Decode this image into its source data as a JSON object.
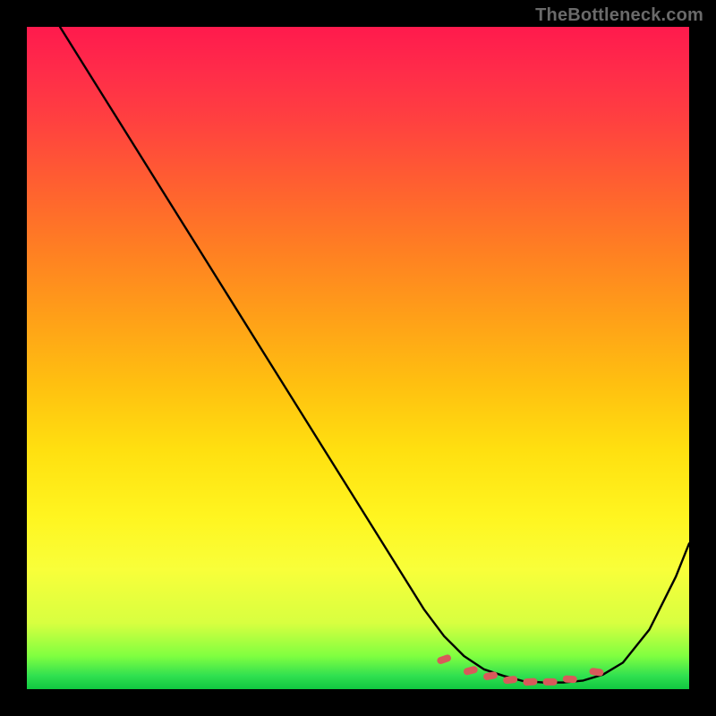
{
  "watermark": "TheBottleneck.com",
  "colors": {
    "frame": "#000000",
    "curve": "#000000",
    "marker": "#d85a5a",
    "gradient_top": "#ff1a4d",
    "gradient_bottom": "#10c840"
  },
  "chart_data": {
    "type": "line",
    "title": "",
    "xlabel": "",
    "ylabel": "",
    "xlim": [
      0,
      100
    ],
    "ylim": [
      0,
      100
    ],
    "grid": false,
    "legend": false,
    "series": [
      {
        "name": "bottleneck-curve",
        "x": [
          5,
          10,
          15,
          20,
          25,
          30,
          35,
          40,
          45,
          50,
          55,
          60,
          63,
          66,
          69,
          72,
          75,
          78,
          81,
          84,
          87,
          90,
          94,
          98,
          100
        ],
        "values": [
          100,
          92,
          84,
          76,
          68,
          60,
          52,
          44,
          36,
          28,
          20,
          12,
          8,
          5,
          3,
          2,
          1.2,
          1,
          1,
          1.3,
          2.2,
          4,
          9,
          17,
          22
        ]
      }
    ],
    "markers": {
      "name": "valley-markers",
      "x": [
        63,
        67,
        70,
        73,
        76,
        79,
        82,
        86
      ],
      "values": [
        4.5,
        2.8,
        2.0,
        1.4,
        1.1,
        1.1,
        1.5,
        2.6
      ]
    }
  }
}
